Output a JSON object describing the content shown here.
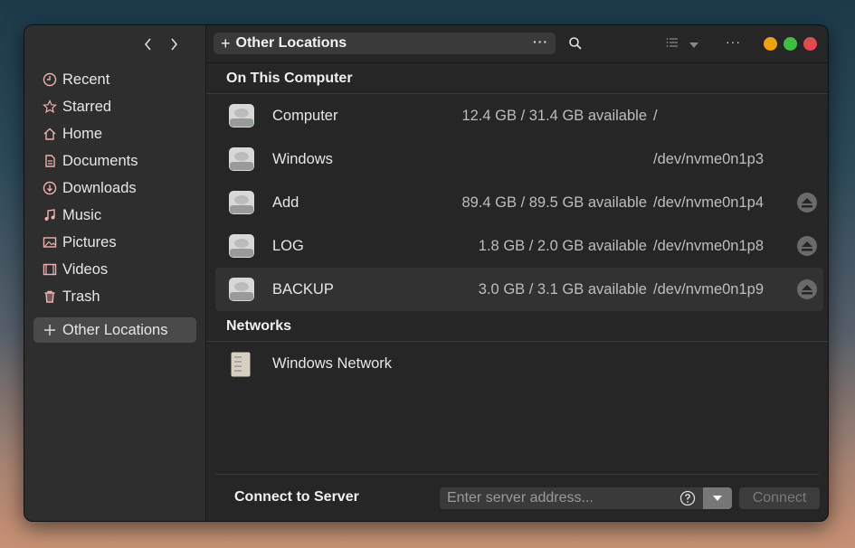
{
  "window": {
    "path_title": "Other Locations"
  },
  "sidebar": {
    "items": [
      {
        "label": "Recent",
        "icon": "clock-icon"
      },
      {
        "label": "Starred",
        "icon": "star-icon"
      },
      {
        "label": "Home",
        "icon": "home-icon"
      },
      {
        "label": "Documents",
        "icon": "documents-icon"
      },
      {
        "label": "Downloads",
        "icon": "download-icon"
      },
      {
        "label": "Music",
        "icon": "music-icon"
      },
      {
        "label": "Pictures",
        "icon": "pictures-icon"
      },
      {
        "label": "Videos",
        "icon": "videos-icon"
      },
      {
        "label": "Trash",
        "icon": "trash-icon"
      }
    ],
    "active_item": "Other Locations"
  },
  "sections": {
    "computer_title": "On This Computer",
    "networks_title": "Networks"
  },
  "drives": [
    {
      "name": "Computer",
      "size": "12.4 GB / 31.4 GB available",
      "device": "/"
    },
    {
      "name": "Windows",
      "size": "",
      "device": "/dev/nvme0n1p3"
    },
    {
      "name": "Add",
      "size": "89.4 GB / 89.5 GB available",
      "device": "/dev/nvme0n1p4"
    },
    {
      "name": "LOG",
      "size": "1.8 GB / 2.0 GB available",
      "device": "/dev/nvme0n1p8"
    },
    {
      "name": "BACKUP",
      "size": "3.0 GB / 3.1 GB available",
      "device": "/dev/nvme0n1p9"
    }
  ],
  "networks": [
    {
      "name": "Windows Network"
    }
  ],
  "footer": {
    "label": "Connect to Server",
    "placeholder": "Enter server address...",
    "connect_label": "Connect"
  },
  "colors": {
    "close": "#e5484d",
    "maximize": "#3fbf3f",
    "minimize": "#f0a30a"
  }
}
